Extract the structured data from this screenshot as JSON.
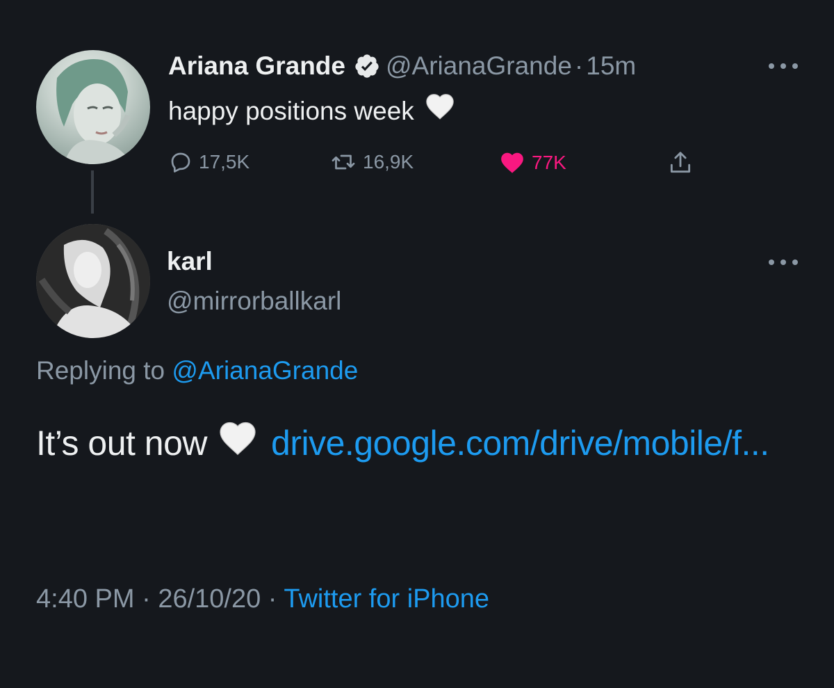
{
  "original_tweet": {
    "name": "Ariana Grande",
    "handle": "@ArianaGrande",
    "separator": "·",
    "time": "15m",
    "text": "happy positions week",
    "reply_count": "17,5K",
    "retweet_count": "16,9K",
    "like_count": "77K"
  },
  "reply_tweet": {
    "name": "karl",
    "handle": "@mirrorballkarl",
    "replying_prefix": "Replying to",
    "replying_to": "@ArianaGrande",
    "text": "It’s out now",
    "link": "drive.google.com/drive/mobile/f...",
    "time": "4:40 PM",
    "separator": "·",
    "date": "26/10/20",
    "source": "Twitter for iPhone"
  },
  "colors": {
    "background": "#15181d",
    "link": "#1d9bf0",
    "muted": "#8b98a5",
    "like": "#f91880"
  },
  "icons": {
    "verified": "verified-badge-icon",
    "more": "more-dots-icon",
    "reply": "reply-bubble-icon",
    "retweet": "retweet-icon",
    "like": "heart-icon",
    "share": "share-icon",
    "emoji": "white-heart-emoji"
  }
}
